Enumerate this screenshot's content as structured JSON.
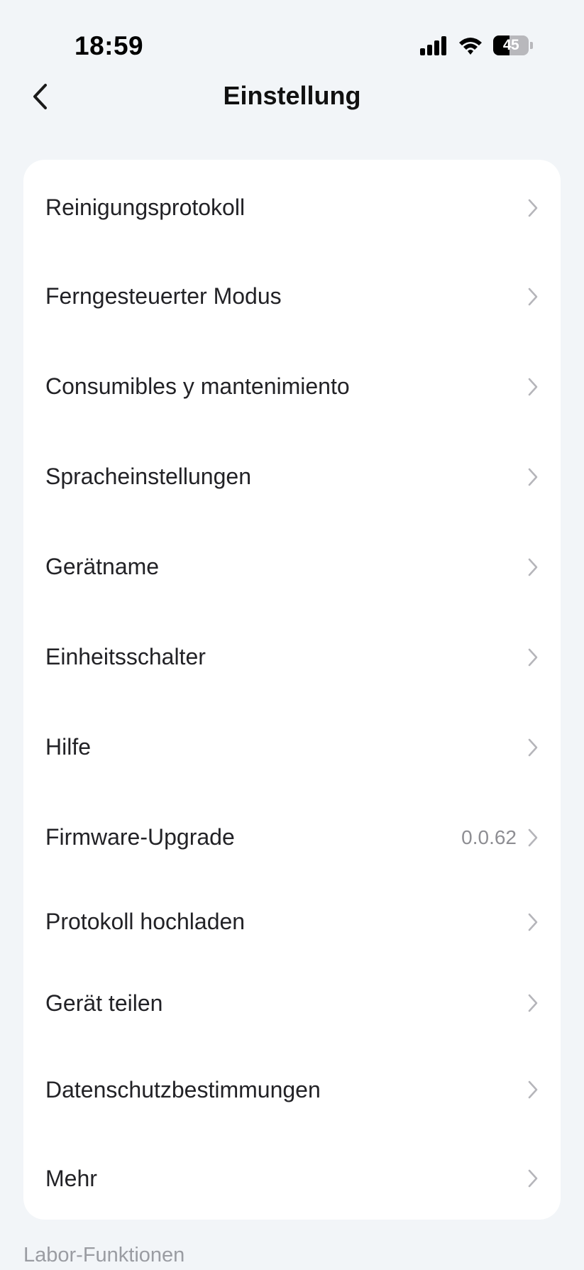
{
  "status_bar": {
    "time": "18:59",
    "battery_level": "45",
    "battery_fraction": 0.45,
    "icons": [
      "signal-icon",
      "wifi-icon",
      "battery-icon"
    ]
  },
  "header": {
    "back_icon": "chevron-left-icon",
    "title": "Einstellung"
  },
  "settings": {
    "items": [
      {
        "label": "Reinigungsprotokoll",
        "value": ""
      },
      {
        "label": "Ferngesteuerter Modus",
        "value": ""
      },
      {
        "label": "Consumibles y mantenimiento",
        "value": ""
      },
      {
        "label": "Spracheinstellungen",
        "value": ""
      },
      {
        "label": "Gerätname",
        "value": ""
      },
      {
        "label": "Einheitsschalter",
        "value": ""
      },
      {
        "label": "Hilfe",
        "value": ""
      },
      {
        "label": "Firmware-Upgrade",
        "value": "0.0.62"
      },
      {
        "label": "Protokoll hochladen",
        "value": ""
      },
      {
        "label": "Gerät teilen",
        "value": ""
      },
      {
        "label": "Datenschutzbestimmungen",
        "value": ""
      },
      {
        "label": "Mehr",
        "value": ""
      }
    ],
    "row_icon": "chevron-right-icon"
  },
  "section": {
    "lab_features_caption": "Labor-Funktionen"
  },
  "colors": {
    "background": "#f2f5f8",
    "card": "#ffffff",
    "text_primary": "#222226",
    "text_secondary": "#8e8e93",
    "chevron": "#b5b5ba"
  }
}
